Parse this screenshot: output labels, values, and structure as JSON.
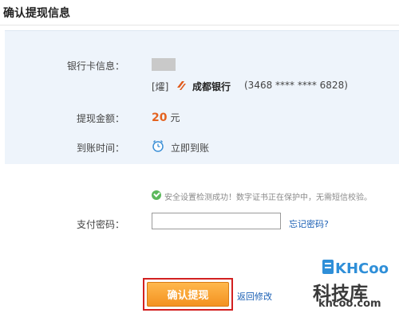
{
  "header": {
    "title": "确认提现信息"
  },
  "bank_info": {
    "label": "银行卡信息：",
    "tag": "[㸌]",
    "bank_name": "成都银行",
    "card_number": "(3468 **** **** 6828)",
    "brand_color": "#e05a1b"
  },
  "amount": {
    "label": "提现金额：",
    "value": "20",
    "unit": "元",
    "color": "#e4621f"
  },
  "arrival": {
    "label": "到账时间：",
    "value": "立即到账",
    "icon": "clock-icon"
  },
  "security": {
    "icon": "check-circle-icon",
    "message": "安全设置检测成功！数字证书正在保护中，无需短信校验。"
  },
  "password": {
    "label": "支付密码：",
    "value": "",
    "forgot_link": "忘记密码?"
  },
  "actions": {
    "confirm_label": "确认提现",
    "back_label": "返回修改",
    "highlight_color": "#d22020"
  },
  "watermark": {
    "logo_text": "KHCoo",
    "cn_text": "科技库",
    "url": "khcoo.com"
  }
}
